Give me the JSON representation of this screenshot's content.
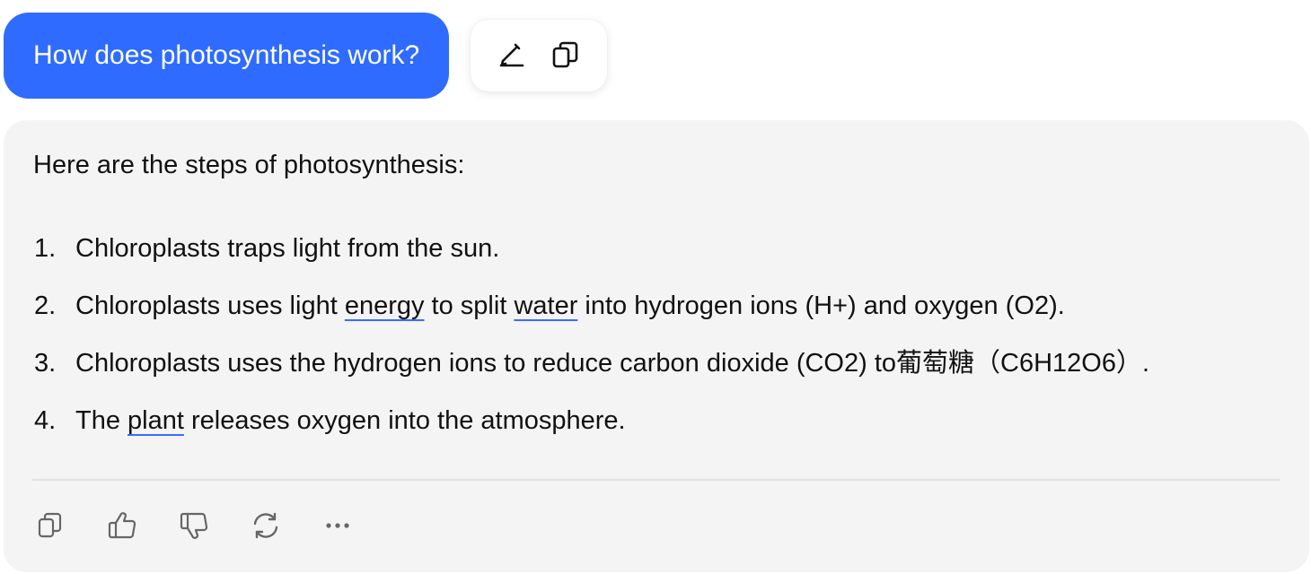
{
  "user_message": {
    "text": "How does photosynthesis work?",
    "bubble_color": "#2f6bff",
    "actions": [
      {
        "icon": "edit-icon",
        "label": "Edit"
      },
      {
        "icon": "copy-icon",
        "label": "Copy"
      }
    ]
  },
  "answer": {
    "intro": "Here are the steps of photosynthesis:",
    "steps": [
      {
        "num": "1.",
        "parts": [
          "Chloroplasts traps light from the sun."
        ]
      },
      {
        "num": "2.",
        "parts": [
          "Chloroplasts uses light ",
          "energy",
          " to split ",
          "water",
          " into hydrogen ions (H+) and oxygen (O2)."
        ]
      },
      {
        "num": "3.",
        "parts": [
          "Chloroplasts uses the hydrogen ions to reduce carbon dioxide (CO2) to葡萄糖（C6H12O6）."
        ]
      },
      {
        "num": "4.",
        "parts": [
          "The ",
          "plant",
          " releases oxygen into the atmosphere."
        ]
      }
    ],
    "linked_terms": [
      "energy",
      "water",
      "plant"
    ],
    "link_underline_color": "#3a6bff",
    "card_background": "#f4f4f4",
    "actions": [
      {
        "icon": "copy-icon"
      },
      {
        "icon": "thumbs-up-icon"
      },
      {
        "icon": "thumbs-down-icon"
      },
      {
        "icon": "regenerate-icon"
      },
      {
        "icon": "more-options-icon"
      }
    ]
  }
}
